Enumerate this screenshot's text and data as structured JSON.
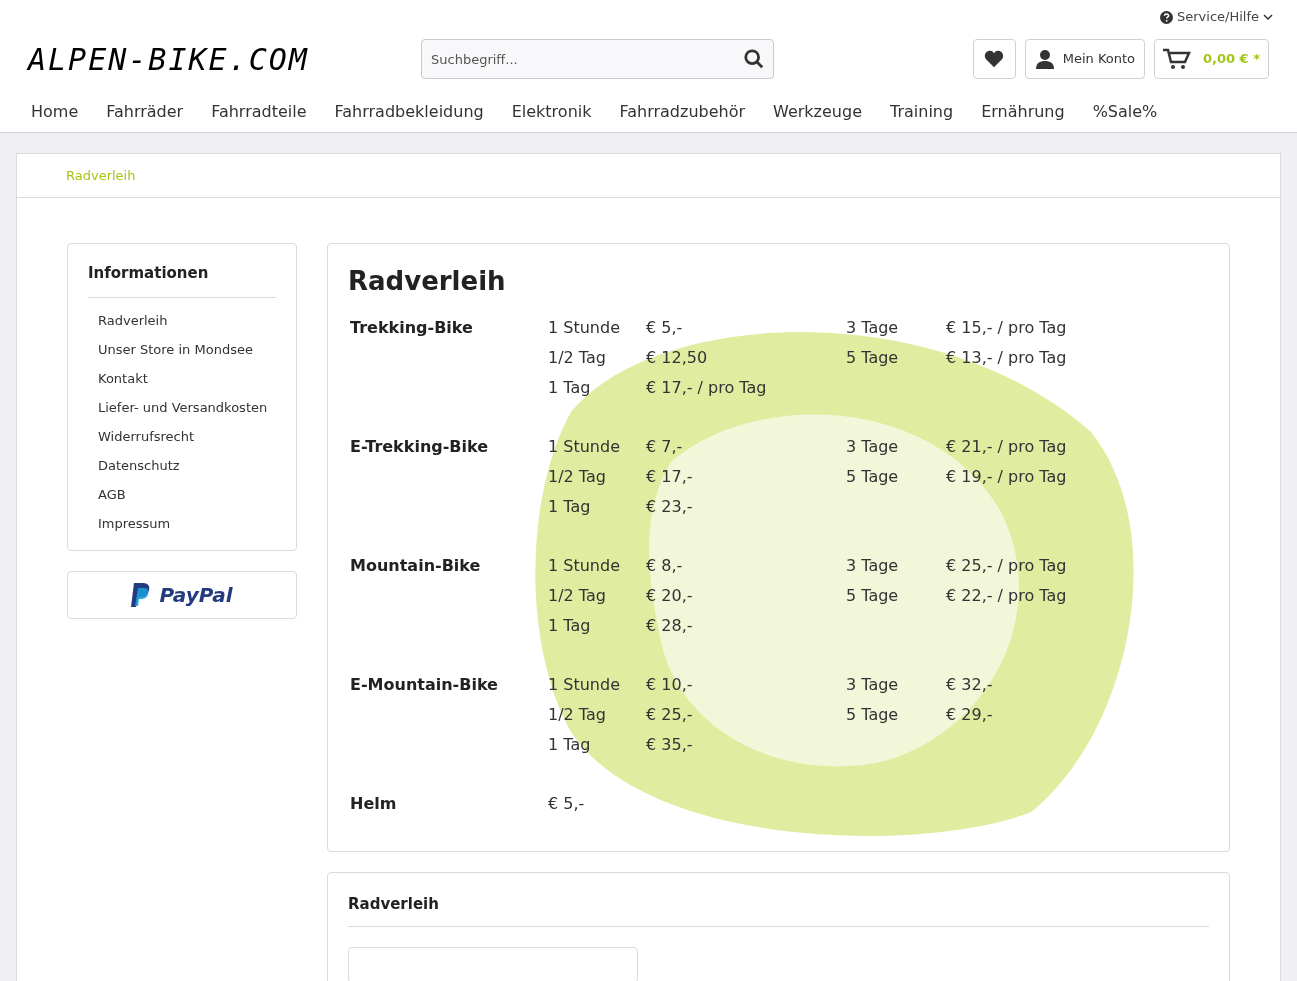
{
  "header": {
    "service_menu": "Service/Hilfe",
    "logo": "ALPEN-BIKE.COM",
    "search": {
      "placeholder": "Suchbegriff..."
    },
    "account": "Mein Konto",
    "cart_total": "0,00 € *"
  },
  "nav": [
    {
      "label": "Home"
    },
    {
      "label": "Fahrräder"
    },
    {
      "label": "Fahrradteile"
    },
    {
      "label": "Fahrradbekleidung"
    },
    {
      "label": "Elektronik"
    },
    {
      "label": "Fahrradzubehör"
    },
    {
      "label": "Werkzeuge"
    },
    {
      "label": "Training"
    },
    {
      "label": "Ernährung"
    },
    {
      "label": "%Sale%"
    }
  ],
  "breadcrumb": "Radverleih",
  "sidebar": {
    "title": "Informationen",
    "items": [
      "Radverleih",
      "Unser Store in Mondsee",
      "Kontakt",
      "Liefer- und Versandkosten",
      "Widerrufsrecht",
      "Datenschutz",
      "AGB",
      "Impressum"
    ],
    "payment": "PayPal"
  },
  "content": {
    "title": "Radverleih",
    "rentals": [
      {
        "name": "Trekking-Bike",
        "rows": [
          [
            "1 Stunde",
            "€ 5,-",
            "3 Tage",
            "€ 15,- / pro Tag"
          ],
          [
            "1/2 Tag",
            "€ 12,50",
            "5 Tage",
            "€ 13,- / pro Tag"
          ],
          [
            "1 Tag",
            "€ 17,- / pro Tag"
          ]
        ]
      },
      {
        "name": "E-Trekking-Bike",
        "rows": [
          [
            "1 Stunde",
            "€ 7,-",
            "3 Tage",
            "€ 21,- / pro Tag"
          ],
          [
            "1/2 Tag",
            "€ 17,-",
            "5 Tage",
            "€ 19,- / pro Tag"
          ],
          [
            "1 Tag",
            "€ 23,-"
          ]
        ]
      },
      {
        "name": "Mountain-Bike",
        "rows": [
          [
            "1 Stunde",
            "€ 8,-",
            "3 Tage",
            "€ 25,- / pro Tag"
          ],
          [
            "1/2 Tag",
            "€ 20,-",
            "5 Tage",
            "€ 22,- / pro Tag"
          ],
          [
            "1 Tag",
            "€ 28,-"
          ]
        ]
      },
      {
        "name": "E-Mountain-Bike",
        "rows": [
          [
            "1 Stunde",
            "€ 10,-",
            "3 Tage",
            "€ 32,-"
          ],
          [
            "1/2 Tag",
            "€ 25,-",
            "5 Tage",
            "€ 29,-"
          ],
          [
            "1 Tag",
            "€ 35,-"
          ]
        ]
      },
      {
        "name": "Helm",
        "rows": [
          [
            "€ 5,-"
          ]
        ]
      }
    ]
  },
  "second_panel": {
    "title": "Radverleih"
  }
}
